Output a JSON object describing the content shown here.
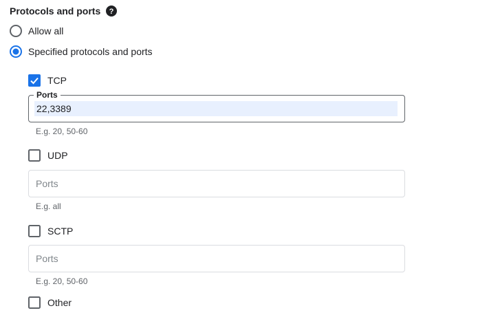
{
  "section": {
    "title": "Protocols and ports",
    "help_icon": "question-circle-icon"
  },
  "radios": {
    "allow_all": {
      "label": "Allow all",
      "selected": false
    },
    "specified": {
      "label": "Specified protocols and ports",
      "selected": true
    }
  },
  "protocols": {
    "tcp": {
      "label": "TCP",
      "checked": true,
      "ports_label": "Ports",
      "ports_value": "22,3389",
      "hint": "E.g. 20, 50-60"
    },
    "udp": {
      "label": "UDP",
      "checked": false,
      "ports_placeholder": "Ports",
      "hint": "E.g. all"
    },
    "sctp": {
      "label": "SCTP",
      "checked": false,
      "ports_placeholder": "Ports",
      "hint": "E.g. 20, 50-60"
    },
    "other": {
      "label": "Other",
      "checked": false
    }
  },
  "colors": {
    "accent": "#1a73e8",
    "text": "#202124",
    "hint": "#5f6368",
    "border": "#dadce0",
    "selection": "#e8f0fe"
  }
}
